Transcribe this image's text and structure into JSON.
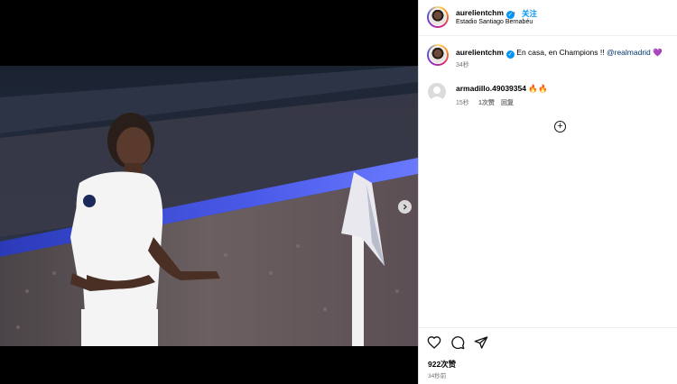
{
  "post": {
    "author": "aurelientchm",
    "follow_label": "关注",
    "location": "Estadio Santiago Bernabéu",
    "separator": "•"
  },
  "caption": {
    "author": "aurelientchm",
    "text": "En casa, en Champions !! ",
    "mention": "@realmadrid",
    "emoji": "💜",
    "time": "34秒"
  },
  "comments": [
    {
      "user": "armadillo.49039354",
      "text": "🔥🔥",
      "time": "15秒",
      "likes": "1次赞",
      "reply": "回复"
    }
  ],
  "add_comments_icon": "plus-circle-icon",
  "actions": {
    "like_icon": "heart-icon",
    "comment_icon": "comment-bubble-icon",
    "share_icon": "paper-plane-icon"
  },
  "stats": {
    "likes": "922次赞",
    "time_ago": "34秒前"
  },
  "media": {
    "next_icon": "chevron-right-icon",
    "tag_icon": "person-tag-icon",
    "carousel_count": 2,
    "carousel_active": 0
  },
  "colors": {
    "accent": "#0095f6",
    "verified": "#0095f6",
    "mention": "#00376b",
    "muted": "#737373"
  }
}
